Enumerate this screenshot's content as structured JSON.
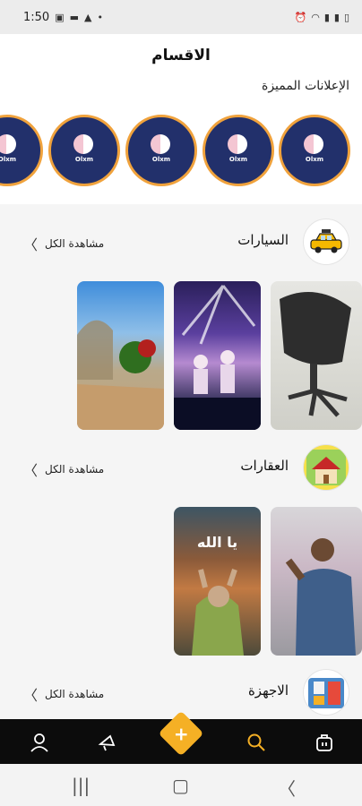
{
  "status_bar": {
    "time": "1:50",
    "left_icons": [
      "gallery-icon",
      "message-icon",
      "alert-icon",
      "dot-icon"
    ],
    "right_icons": [
      "alarm-icon",
      "wifi-icon",
      "signal-icon",
      "signal-icon",
      "battery-icon"
    ]
  },
  "header": {
    "title": "الاقسام"
  },
  "featured": {
    "title": "الإعلانات المميزة",
    "ads": [
      {
        "brand": "Olxm"
      },
      {
        "brand": "Olxm"
      },
      {
        "brand": "Olxm"
      },
      {
        "brand": "Olxm"
      },
      {
        "brand": "Olxm"
      }
    ]
  },
  "categories": [
    {
      "name": "السيارات",
      "see_all": "مشاهدة الكل",
      "icon": "taxi-icon"
    },
    {
      "name": "العقارات",
      "see_all": "مشاهدة الكل",
      "icon": "house-icon"
    },
    {
      "name": "الاجهزة",
      "see_all": "مشاهدة الكل",
      "icon": "devices-icon"
    }
  ],
  "thumbnails": {
    "cars": [
      "office-chair-photo",
      "concert-stage-photo",
      "trees-road-photo"
    ],
    "real_estate": [
      "man-photo",
      "praying-figure-photo"
    ],
    "overlay_text": "يا الله"
  },
  "bottom_nav": [
    "profile-icon",
    "megaphone-icon",
    "add-icon",
    "search-icon",
    "shop-icon"
  ],
  "colors": {
    "accent": "#f5b025",
    "featured_circle": "#22306b",
    "circle_border": "#f0a23c"
  }
}
